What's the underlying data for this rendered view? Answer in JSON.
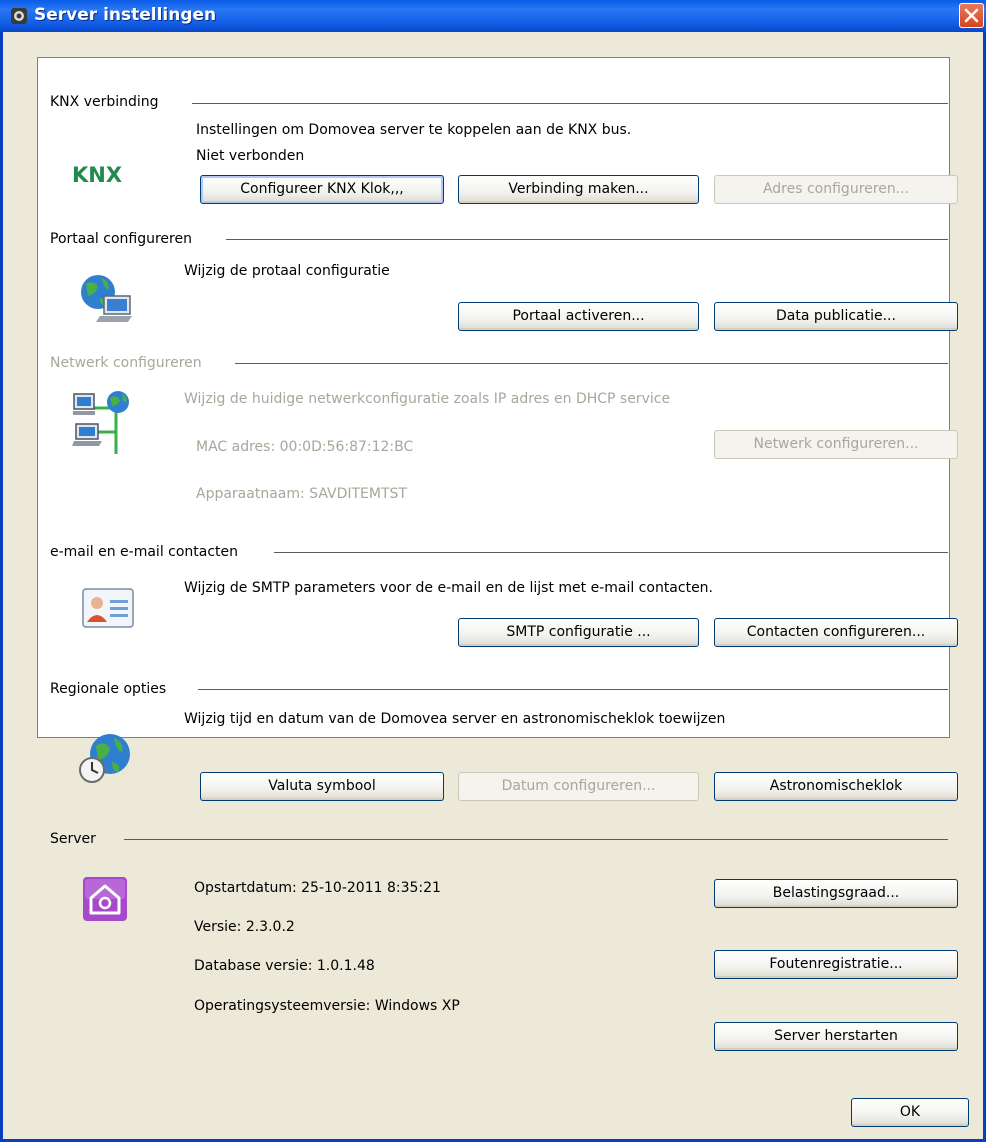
{
  "window": {
    "title": "Server instellingen"
  },
  "knx": {
    "header": "KNX verbinding",
    "description": "Instellingen om Domovea server te koppelen aan de KNX bus.",
    "status": "Niet verbonden",
    "logo_text": "KNX",
    "buttons": {
      "clock": "Configureer KNX Klok,,,",
      "connect": "Verbinding maken...",
      "address": "Adres configureren..."
    }
  },
  "portal": {
    "header": "Portaal configureren",
    "description": "Wijzig de protaal configuratie",
    "buttons": {
      "activate": "Portaal activeren...",
      "publish": "Data publicatie..."
    }
  },
  "network": {
    "header": "Netwerk configureren",
    "description": "Wijzig de huidige netwerkconfiguratie zoals IP adres en DHCP service",
    "mac": "MAC adres: 00:0D:56:87:12:BC",
    "device": "Apparaatnaam: SAVDITEMTST",
    "buttons": {
      "configure": "Netwerk configureren..."
    }
  },
  "email": {
    "header": "e-mail en e-mail contacten",
    "description": "Wijzig de SMTP parameters voor de e-mail en de lijst met e-mail contacten.",
    "buttons": {
      "smtp": "SMTP configuratie ...",
      "contacts": "Contacten configureren..."
    }
  },
  "regional": {
    "header": "Regionale opties",
    "description": "Wijzig tijd en datum van de Domovea server en astronomischeklok toewijzen",
    "buttons": {
      "currency": "Valuta symbool",
      "date": "Datum configureren...",
      "astro": "Astronomischeklok"
    }
  },
  "server": {
    "header": "Server",
    "startup": "Opstartdatum: 25-10-2011 8:35:21",
    "version": "Versie: 2.3.0.2",
    "db_version": "Database versie: 1.0.1.48",
    "os_version": "Operatingsysteemversie: Windows XP",
    "buttons": {
      "load": "Belastingsgraad...",
      "errors": "Foutenregistratie...",
      "restart": "Server herstarten"
    }
  },
  "footer": {
    "ok": "OK"
  },
  "colors": {
    "titlebar": "#0a5ce6",
    "dialog_bg": "#ece9d8",
    "panel_bg": "#ffffff",
    "disabled_text": "#a7a79a",
    "close_button": "#d6431f"
  }
}
